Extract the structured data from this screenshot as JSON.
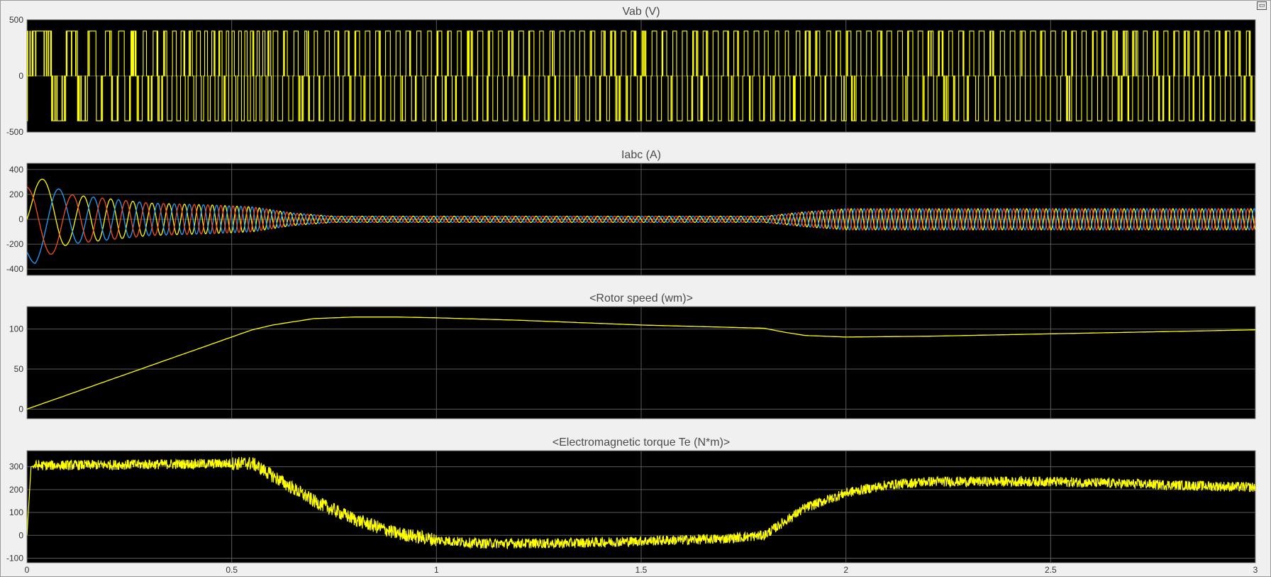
{
  "colors": {
    "background": "#000000",
    "frame": "#f0f0f0",
    "grid": "#5a5a5a",
    "yellow": "#ffff00",
    "blue": "#1ea1ff",
    "orange": "#ff4d1a"
  },
  "toolbar": {
    "restore_icon": "restore-icon"
  },
  "chart_data": [
    {
      "type": "line",
      "title": "Vab (V)",
      "xlim": [
        0,
        3
      ],
      "ylim": [
        -500,
        500
      ],
      "yticks": [
        -500,
        0,
        500
      ],
      "grid": true,
      "series": [
        {
          "color": "#ffff00",
          "kind": "pwm",
          "x": [
            0,
            3
          ],
          "levels": [
            -400,
            0,
            400
          ]
        }
      ]
    },
    {
      "type": "line",
      "title": "Iabc (A)",
      "xlim": [
        0,
        3
      ],
      "ylim": [
        -450,
        450
      ],
      "yticks": [
        -400,
        -200,
        0,
        200,
        400
      ],
      "grid": true,
      "series": [
        {
          "color": "#ffff00",
          "phase_deg": 0
        },
        {
          "color": "#1ea1ff",
          "phase_deg": 120
        },
        {
          "color": "#ff4d1a",
          "phase_deg": 240
        }
      ],
      "envelope": {
        "x": [
          0,
          0.02,
          0.1,
          0.3,
          0.45,
          0.55,
          0.65,
          0.75,
          1.8,
          1.9,
          2.0,
          2.5,
          3.0
        ],
        "amplitude": [
          300,
          360,
          200,
          130,
          115,
          100,
          50,
          25,
          25,
          60,
          85,
          85,
          85
        ]
      },
      "frequency_hz": {
        "x": [
          0,
          0.6,
          1.8,
          2.0,
          3.0
        ],
        "f": [
          5,
          40,
          40,
          42,
          42
        ]
      }
    },
    {
      "type": "line",
      "title": "<Rotor speed (wm)>",
      "xlim": [
        0,
        3
      ],
      "ylim": [
        -12,
        128
      ],
      "yticks": [
        0,
        50,
        100
      ],
      "grid": true,
      "series": [
        {
          "color": "#ffff00",
          "x": [
            0,
            0.55,
            0.6,
            0.7,
            0.8,
            0.9,
            1.0,
            1.2,
            1.5,
            1.8,
            1.85,
            1.9,
            2.0,
            2.2,
            2.5,
            2.8,
            3.0
          ],
          "y": [
            0,
            99,
            105,
            113,
            115,
            115,
            114,
            111,
            105,
            101,
            96,
            92,
            90,
            91,
            94,
            97,
            99
          ]
        }
      ]
    },
    {
      "type": "line",
      "title": "<Electromagnetic torque Te (N*m)>",
      "xlim": [
        0,
        3
      ],
      "ylim": [
        -120,
        370
      ],
      "yticks": [
        -100,
        0,
        100,
        200,
        300
      ],
      "grid": true,
      "series": [
        {
          "color": "#ffff00",
          "noisy": true,
          "x": [
            0,
            0.01,
            0.02,
            0.3,
            0.55,
            0.6,
            0.7,
            0.8,
            0.9,
            1.0,
            1.1,
            1.3,
            1.5,
            1.7,
            1.8,
            1.85,
            1.9,
            2.0,
            2.1,
            2.2,
            2.5,
            2.8,
            3.0
          ],
          "y": [
            0,
            300,
            305,
            310,
            315,
            260,
            150,
            70,
            10,
            -20,
            -35,
            -35,
            -25,
            -15,
            0,
            60,
            120,
            185,
            220,
            235,
            235,
            220,
            210
          ]
        }
      ]
    }
  ],
  "xaxis": {
    "ticks": [
      0,
      0.5,
      1,
      1.5,
      2,
      2.5,
      3
    ]
  }
}
